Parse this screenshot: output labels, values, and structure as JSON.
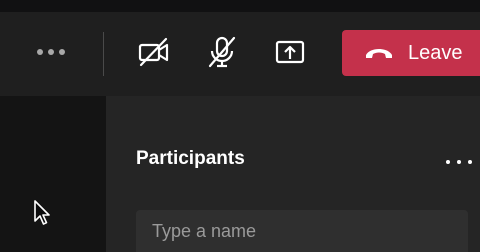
{
  "toolbar": {
    "more_icon": "more-horizontal-icon",
    "camera_icon": "camera-off-icon",
    "mic_icon": "mic-off-icon",
    "share_icon": "share-screen-icon",
    "leave": {
      "label": "Leave",
      "icon": "hang-up-phone-icon",
      "color": "#c4314b"
    }
  },
  "participants_panel": {
    "title": "Participants",
    "more_icon": "more-horizontal-icon",
    "search": {
      "value": "",
      "placeholder": "Type a name"
    }
  },
  "colors": {
    "toolbar_bg": "#1f1f1f",
    "panel_bg": "#252525",
    "left_bg": "#141414",
    "input_bg": "#2f2f2f"
  }
}
